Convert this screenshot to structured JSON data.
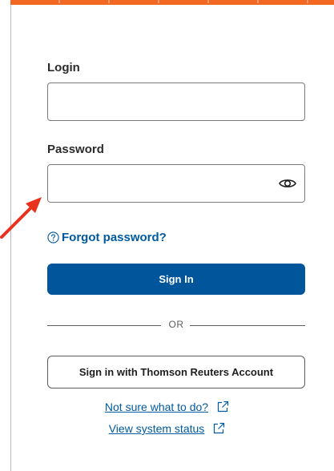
{
  "colors": {
    "accent": "#f26722",
    "primary_button": "#00559b",
    "link": "#005aa0"
  },
  "login": {
    "label": "Login",
    "value": ""
  },
  "password": {
    "label": "Password",
    "value": "",
    "toggle_icon": "eye-icon"
  },
  "forgot_password": {
    "icon": "help-circle-icon",
    "label": "Forgot password?"
  },
  "sign_in_button": {
    "label": "Sign In"
  },
  "divider": {
    "label": "OR"
  },
  "tr_account_button": {
    "label": "Sign in with Thomson Reuters Account"
  },
  "help_links": [
    {
      "label": "Not sure what to do?",
      "icon": "external-link-icon"
    },
    {
      "label": "View system status",
      "icon": "external-link-icon"
    }
  ]
}
